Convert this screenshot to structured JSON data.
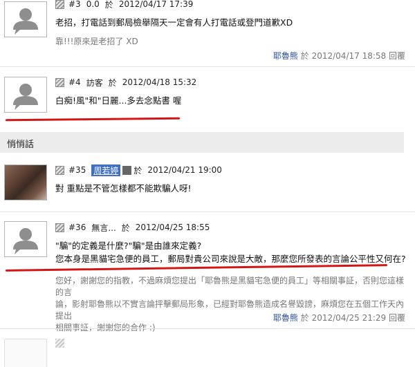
{
  "comments": [
    {
      "num": "#3",
      "author": "0.0",
      "on": "於",
      "date": "2012/04/17 17:39",
      "lines": [
        "老招，打電話到郵局檢舉隔天一定會有人打電話或登門道歉XD"
      ],
      "reply_lines": [
        "靠!!!原來是老招了 XD"
      ],
      "reply_author": "耶魯熊",
      "reply_on": "於",
      "reply_date": "2012/04/17 18:58",
      "reply_action": "回覆"
    },
    {
      "num": "#4",
      "author": "訪客",
      "on": "於",
      "date": "2012/04/18 15:32",
      "lines": [
        "白痴!風\"和\"日麗...多去念點書 喔"
      ]
    }
  ],
  "section": {
    "label": "悄悄話"
  },
  "comment35": {
    "num": "#35",
    "author": "周若婷",
    "on": "於",
    "date": "2012/04/21 19:00",
    "lines": [
      "對 重點是不管怎樣都不能欺騙人呀!"
    ]
  },
  "comment36": {
    "num": "#36",
    "author": "無言...",
    "on": "於",
    "date": "2012/04/25 18:55",
    "lines": [
      "\"騙\"的定義是什麼?\"騙\"是由誰來定義?",
      "您本身是黑貓宅急便的員工，郵局對貴公司來說是大敵，那麼您所發表的言論公平性又何在?"
    ],
    "reply_lines": [
      "您好，謝謝您的指教，不過麻煩您提出「耶魯熊是黑貓宅急便的員工」等相關事証，否則您這樣的言",
      "論，影射耶魯熊以不實言論抨擊郵局形象，已經對耶魯熊造成名譽毀謗，麻煩您在五個工作天內提出",
      "相關事証，謝謝您的合作 :)"
    ],
    "reply_author": "耶魯熊",
    "reply_on": "於",
    "reply_date": "2012/04/25 21:29",
    "reply_action": "回覆"
  },
  "colors": {
    "underline": "#d21515",
    "link": "#2a4f9c",
    "highlight": "#3f6fc4"
  },
  "icons": {
    "avatar": "default-user-avatar-icon",
    "num": "hatched-square-icon"
  }
}
